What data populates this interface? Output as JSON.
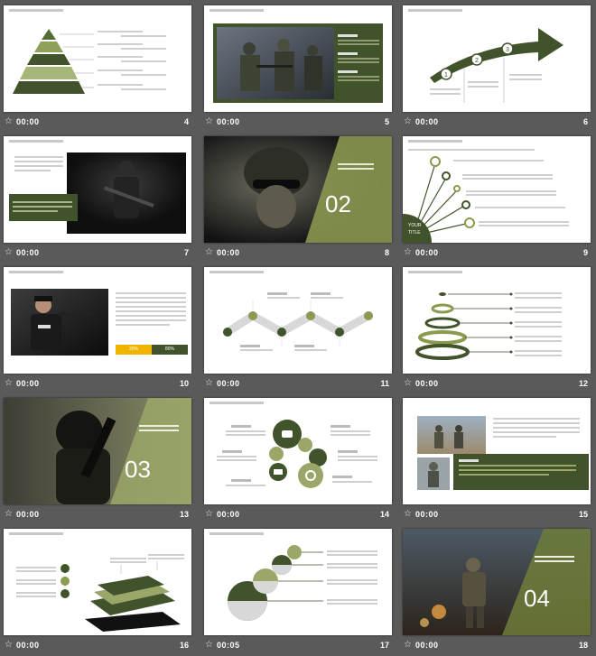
{
  "slides": [
    {
      "time": "00:00",
      "number": "4"
    },
    {
      "time": "00:00",
      "number": "5"
    },
    {
      "time": "00:00",
      "number": "6"
    },
    {
      "time": "00:00",
      "number": "7"
    },
    {
      "time": "00:00",
      "number": "8"
    },
    {
      "time": "00:00",
      "number": "9"
    },
    {
      "time": "00:00",
      "number": "10"
    },
    {
      "time": "00:00",
      "number": "11"
    },
    {
      "time": "00:00",
      "number": "12"
    },
    {
      "time": "00:00",
      "number": "13"
    },
    {
      "time": "00:00",
      "number": "14"
    },
    {
      "time": "00:00",
      "number": "15"
    },
    {
      "time": "00:00",
      "number": "16"
    },
    {
      "time": "00:05",
      "number": "17"
    },
    {
      "time": "00:00",
      "number": "18"
    }
  ],
  "slide_text": {
    "s6_steps": [
      "1",
      "2",
      "3"
    ],
    "s8_big": "02",
    "s9_label1": "YOUR",
    "s9_label2": "TITLE",
    "s10_bar1": "20%",
    "s10_bar2": "80%",
    "s13_big": "03",
    "s18_big": "04"
  },
  "colors": {
    "accent": "#40532b",
    "light_accent": "#9aa768",
    "bg": "#5a5a5a",
    "yellow": "#f0b400"
  }
}
